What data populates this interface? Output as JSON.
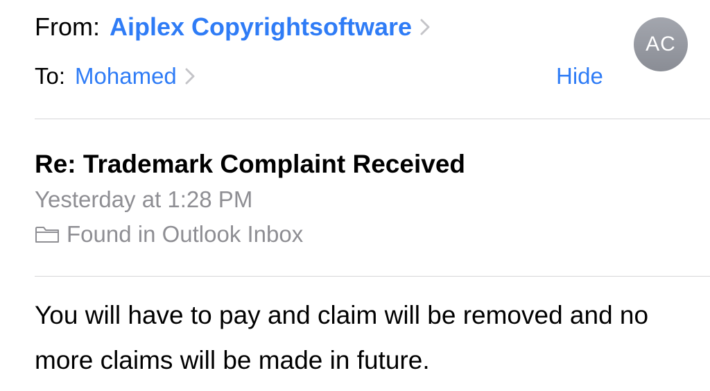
{
  "header": {
    "from_label": "From:",
    "sender_name": "Aiplex Copyrightsoftware",
    "to_label": "To:",
    "recipient_name": "Mohamed",
    "hide_label": "Hide",
    "avatar_initials": "AC"
  },
  "message": {
    "subject": "Re: Trademark Complaint Received",
    "date": "Yesterday at 1:28 PM",
    "folder": "Found in Outlook Inbox",
    "body": "You will have to pay and claim will be removed and no more claims will be made in future."
  },
  "icons": {
    "sender_chevron": "chevron-right-icon",
    "recipient_chevron": "chevron-right-icon",
    "folder": "folder-icon"
  },
  "colors": {
    "link": "#2f7cf6",
    "secondary_text": "#8e8e93",
    "avatar_bg": "#9a9da5",
    "divider": "#d5d5d8"
  }
}
